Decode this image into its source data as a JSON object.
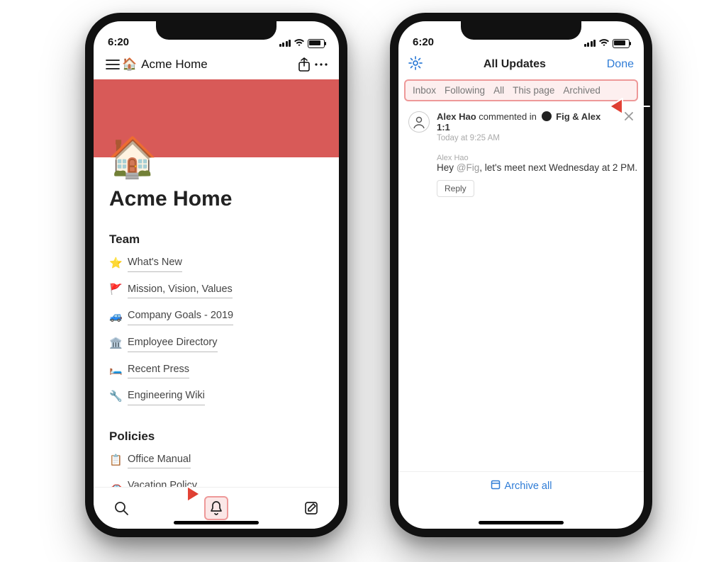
{
  "status": {
    "time": "6:20"
  },
  "leftPhone": {
    "breadcrumb": "Acme Home",
    "heroEmoji": "🏠",
    "pageTitle": "Acme Home",
    "sections": {
      "team": {
        "title": "Team",
        "items": [
          {
            "icon": "⭐",
            "label": "What's New"
          },
          {
            "icon": "🚩",
            "label": "Mission, Vision, Values"
          },
          {
            "icon": "🚙",
            "label": "Company Goals - 2019"
          },
          {
            "icon": "🏛️",
            "label": "Employee Directory"
          },
          {
            "icon": "🛏️",
            "label": "Recent Press"
          },
          {
            "icon": "🔧",
            "label": "Engineering Wiki"
          }
        ]
      },
      "policies": {
        "title": "Policies",
        "items": [
          {
            "icon": "📋",
            "label": "Office Manual"
          },
          {
            "icon": "🚗",
            "label": "Vacation Policy"
          }
        ]
      }
    }
  },
  "rightPhone": {
    "title": "All Updates",
    "done": "Done",
    "tabs": [
      "Inbox",
      "Following",
      "All",
      "This page",
      "Archived"
    ],
    "notification": {
      "author": "Alex Hao",
      "verb": "commented in",
      "context": "Fig & Alex 1:1",
      "timestamp": "Today at 9:25 AM"
    },
    "comment": {
      "author": "Alex Hao",
      "prefix": "Hey ",
      "mention": "@Fig",
      "rest": ", let's meet next Wednesday at 2 PM."
    },
    "reply": "Reply",
    "archiveAll": "Archive all"
  }
}
